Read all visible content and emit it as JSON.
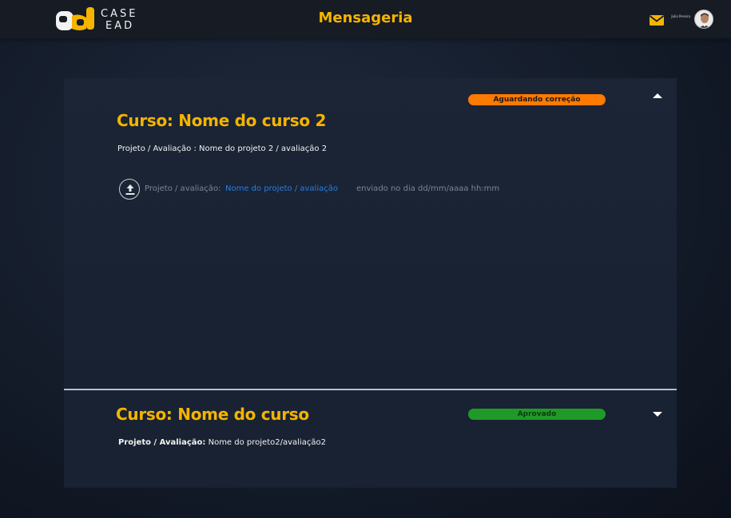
{
  "header": {
    "logo_text_line1": "CASE",
    "logo_text_line2": "EAD",
    "title": "Mensageria",
    "user_name": "Júlio Pereira",
    "accent": "#f4b400"
  },
  "courses": [
    {
      "status": "Aguardando correção",
      "status_color": "#ff7a00",
      "expanded": true,
      "title": "Curso: Nome do curso 2",
      "project_line": "Projeto / Avaliação : Nome do projeto 2 / avaliação 2",
      "submission": {
        "prefix": "Projeto / avaliação:",
        "link": "Nome do projeto / avaliação",
        "sent": "enviado no dia dd/mm/aaaa hh:mm"
      }
    },
    {
      "status": "Aprovado",
      "status_color": "#1f9a28",
      "expanded": false,
      "title": "Curso: Nome do curso",
      "project_label": "Projeto / Avaliação:",
      "project_value": "Nome do projeto2/avaliação2"
    }
  ],
  "icons": {
    "mail": "mail-icon",
    "upload": "upload-icon",
    "collapse": "chevron-up-icon",
    "expand": "chevron-down-icon"
  }
}
